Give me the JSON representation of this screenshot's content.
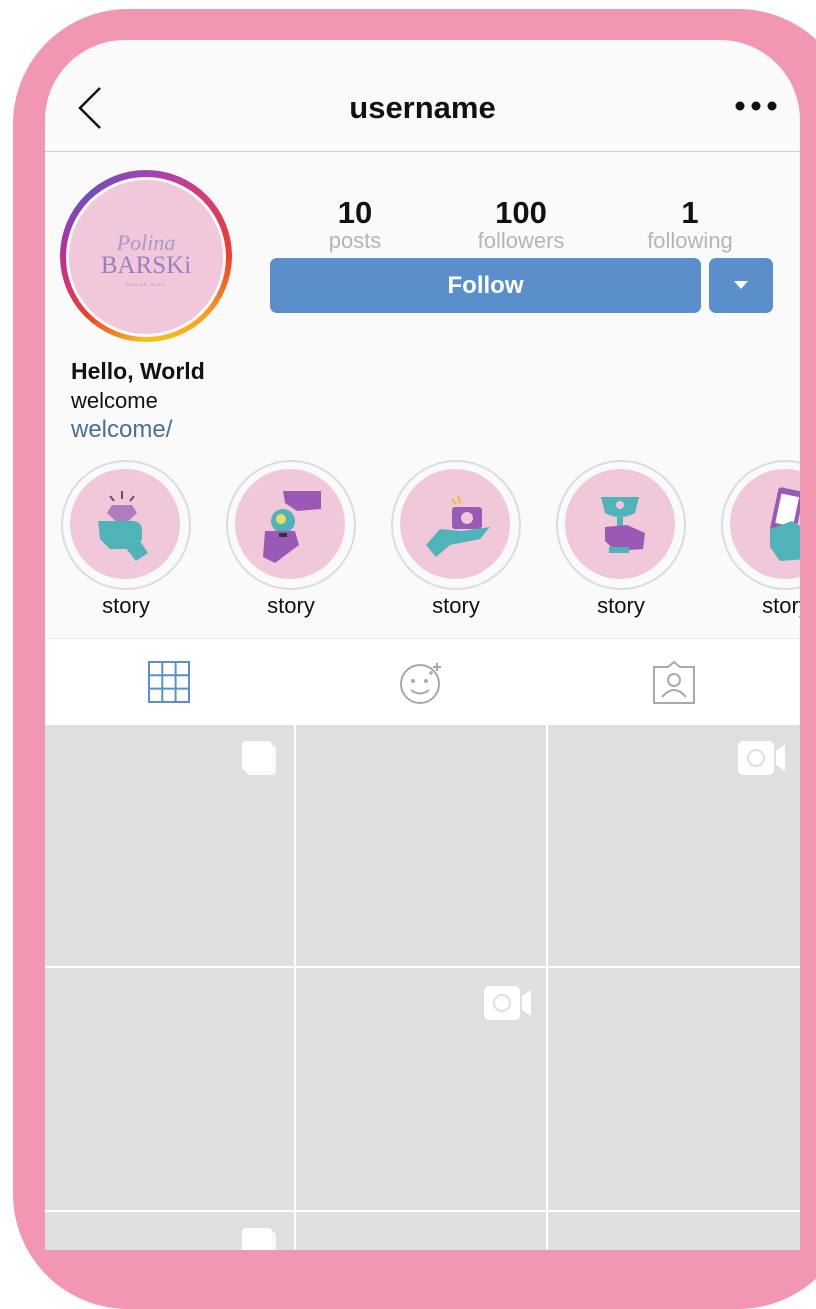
{
  "header": {
    "title": "username",
    "back_icon": "chevron-left-icon",
    "more_icon": "more-horizontal-icon"
  },
  "profile": {
    "avatar_logo": {
      "line1": "Polina",
      "line2": "BARSKi",
      "line3": "GOODS GIRL"
    },
    "stats": [
      {
        "value": "10",
        "label": "posts"
      },
      {
        "value": "100",
        "label": "followers"
      },
      {
        "value": "1",
        "label": "following"
      }
    ],
    "follow_label": "Follow",
    "dropdown_icon": "caret-down-icon",
    "name": "Hello, World",
    "bio": "welcome",
    "link": "welcome/"
  },
  "highlights": [
    {
      "label": "story",
      "icon": "hand-diamond-icon"
    },
    {
      "label": "story",
      "icon": "hand-globe-icon"
    },
    {
      "label": "story",
      "icon": "hand-camera-icon"
    },
    {
      "label": "story",
      "icon": "hand-trophy-icon"
    },
    {
      "label": "story",
      "icon": "hand-phone-icon"
    }
  ],
  "tabs": [
    {
      "icon": "grid-icon",
      "active": true
    },
    {
      "icon": "sticker-face-icon",
      "active": false
    },
    {
      "icon": "tagged-person-icon",
      "active": false
    }
  ],
  "posts": [
    {
      "badge": "carousel-icon"
    },
    {
      "badge": ""
    },
    {
      "badge": "video-icon"
    },
    {
      "badge": ""
    },
    {
      "badge": "video-icon"
    },
    {
      "badge": ""
    },
    {
      "badge": "carousel-icon"
    },
    {
      "badge": ""
    },
    {
      "badge": ""
    }
  ],
  "colors": {
    "frame": "#f197b2",
    "accent": "#5b8fcc",
    "link": "#4a6f95",
    "pink": "#f0c8da",
    "teal": "#4fb3b8",
    "purple": "#9b59b6"
  }
}
